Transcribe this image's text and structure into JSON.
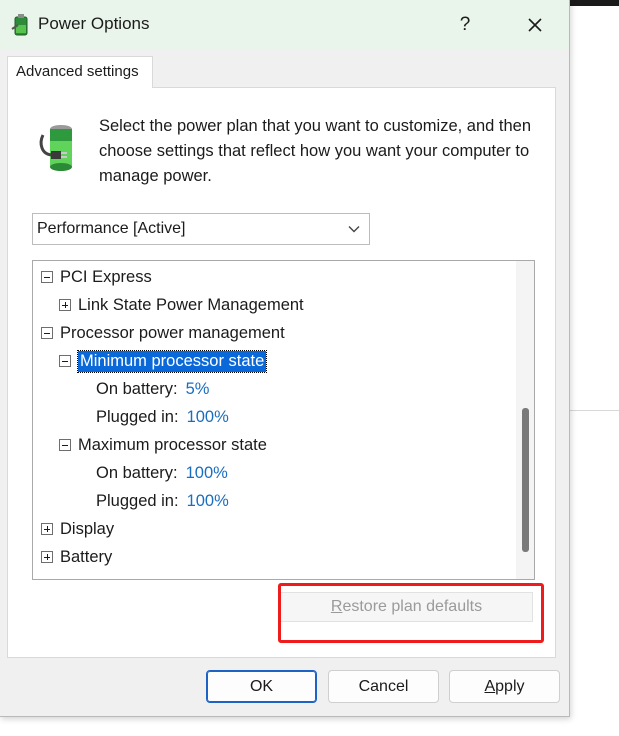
{
  "window": {
    "title": "Power Options",
    "help_glyph": "?",
    "close_icon": "close-icon",
    "app_icon": "power-options-battery-icon"
  },
  "tab": {
    "label": "Advanced settings"
  },
  "description": "Select the power plan that you want to customize, and then choose settings that reflect how you want your computer to manage power.",
  "plan_select": {
    "value": "Performance [Active]",
    "icon": "chevron-down-icon"
  },
  "tree": {
    "items": [
      {
        "label": "PCI Express",
        "expander": "minus"
      },
      {
        "label": "Link State Power Management",
        "expander": "plus"
      },
      {
        "label": "Processor power management",
        "expander": "minus"
      },
      {
        "label": "Minimum processor state",
        "expander": "minus",
        "selected": true
      },
      {
        "label": "On battery:",
        "value": "5%"
      },
      {
        "label": "Plugged in:",
        "value": "100%"
      },
      {
        "label": "Maximum processor state",
        "expander": "minus"
      },
      {
        "label": "On battery:",
        "value": "100%"
      },
      {
        "label": "Plugged in:",
        "value": "100%"
      },
      {
        "label": "Display",
        "expander": "plus"
      },
      {
        "label": "Battery",
        "expander": "plus"
      }
    ]
  },
  "restore_button": {
    "label_first": "R",
    "label_rest": "estore plan defaults",
    "enabled": false
  },
  "buttons": {
    "ok": "OK",
    "cancel": "Cancel",
    "apply_first": "A",
    "apply_rest": "pply"
  },
  "colors": {
    "selection": "#0a68d8",
    "value_link": "#1a6ec0",
    "highlight_box": "#ee1c1c",
    "titlebar": "#e9f4ea"
  }
}
